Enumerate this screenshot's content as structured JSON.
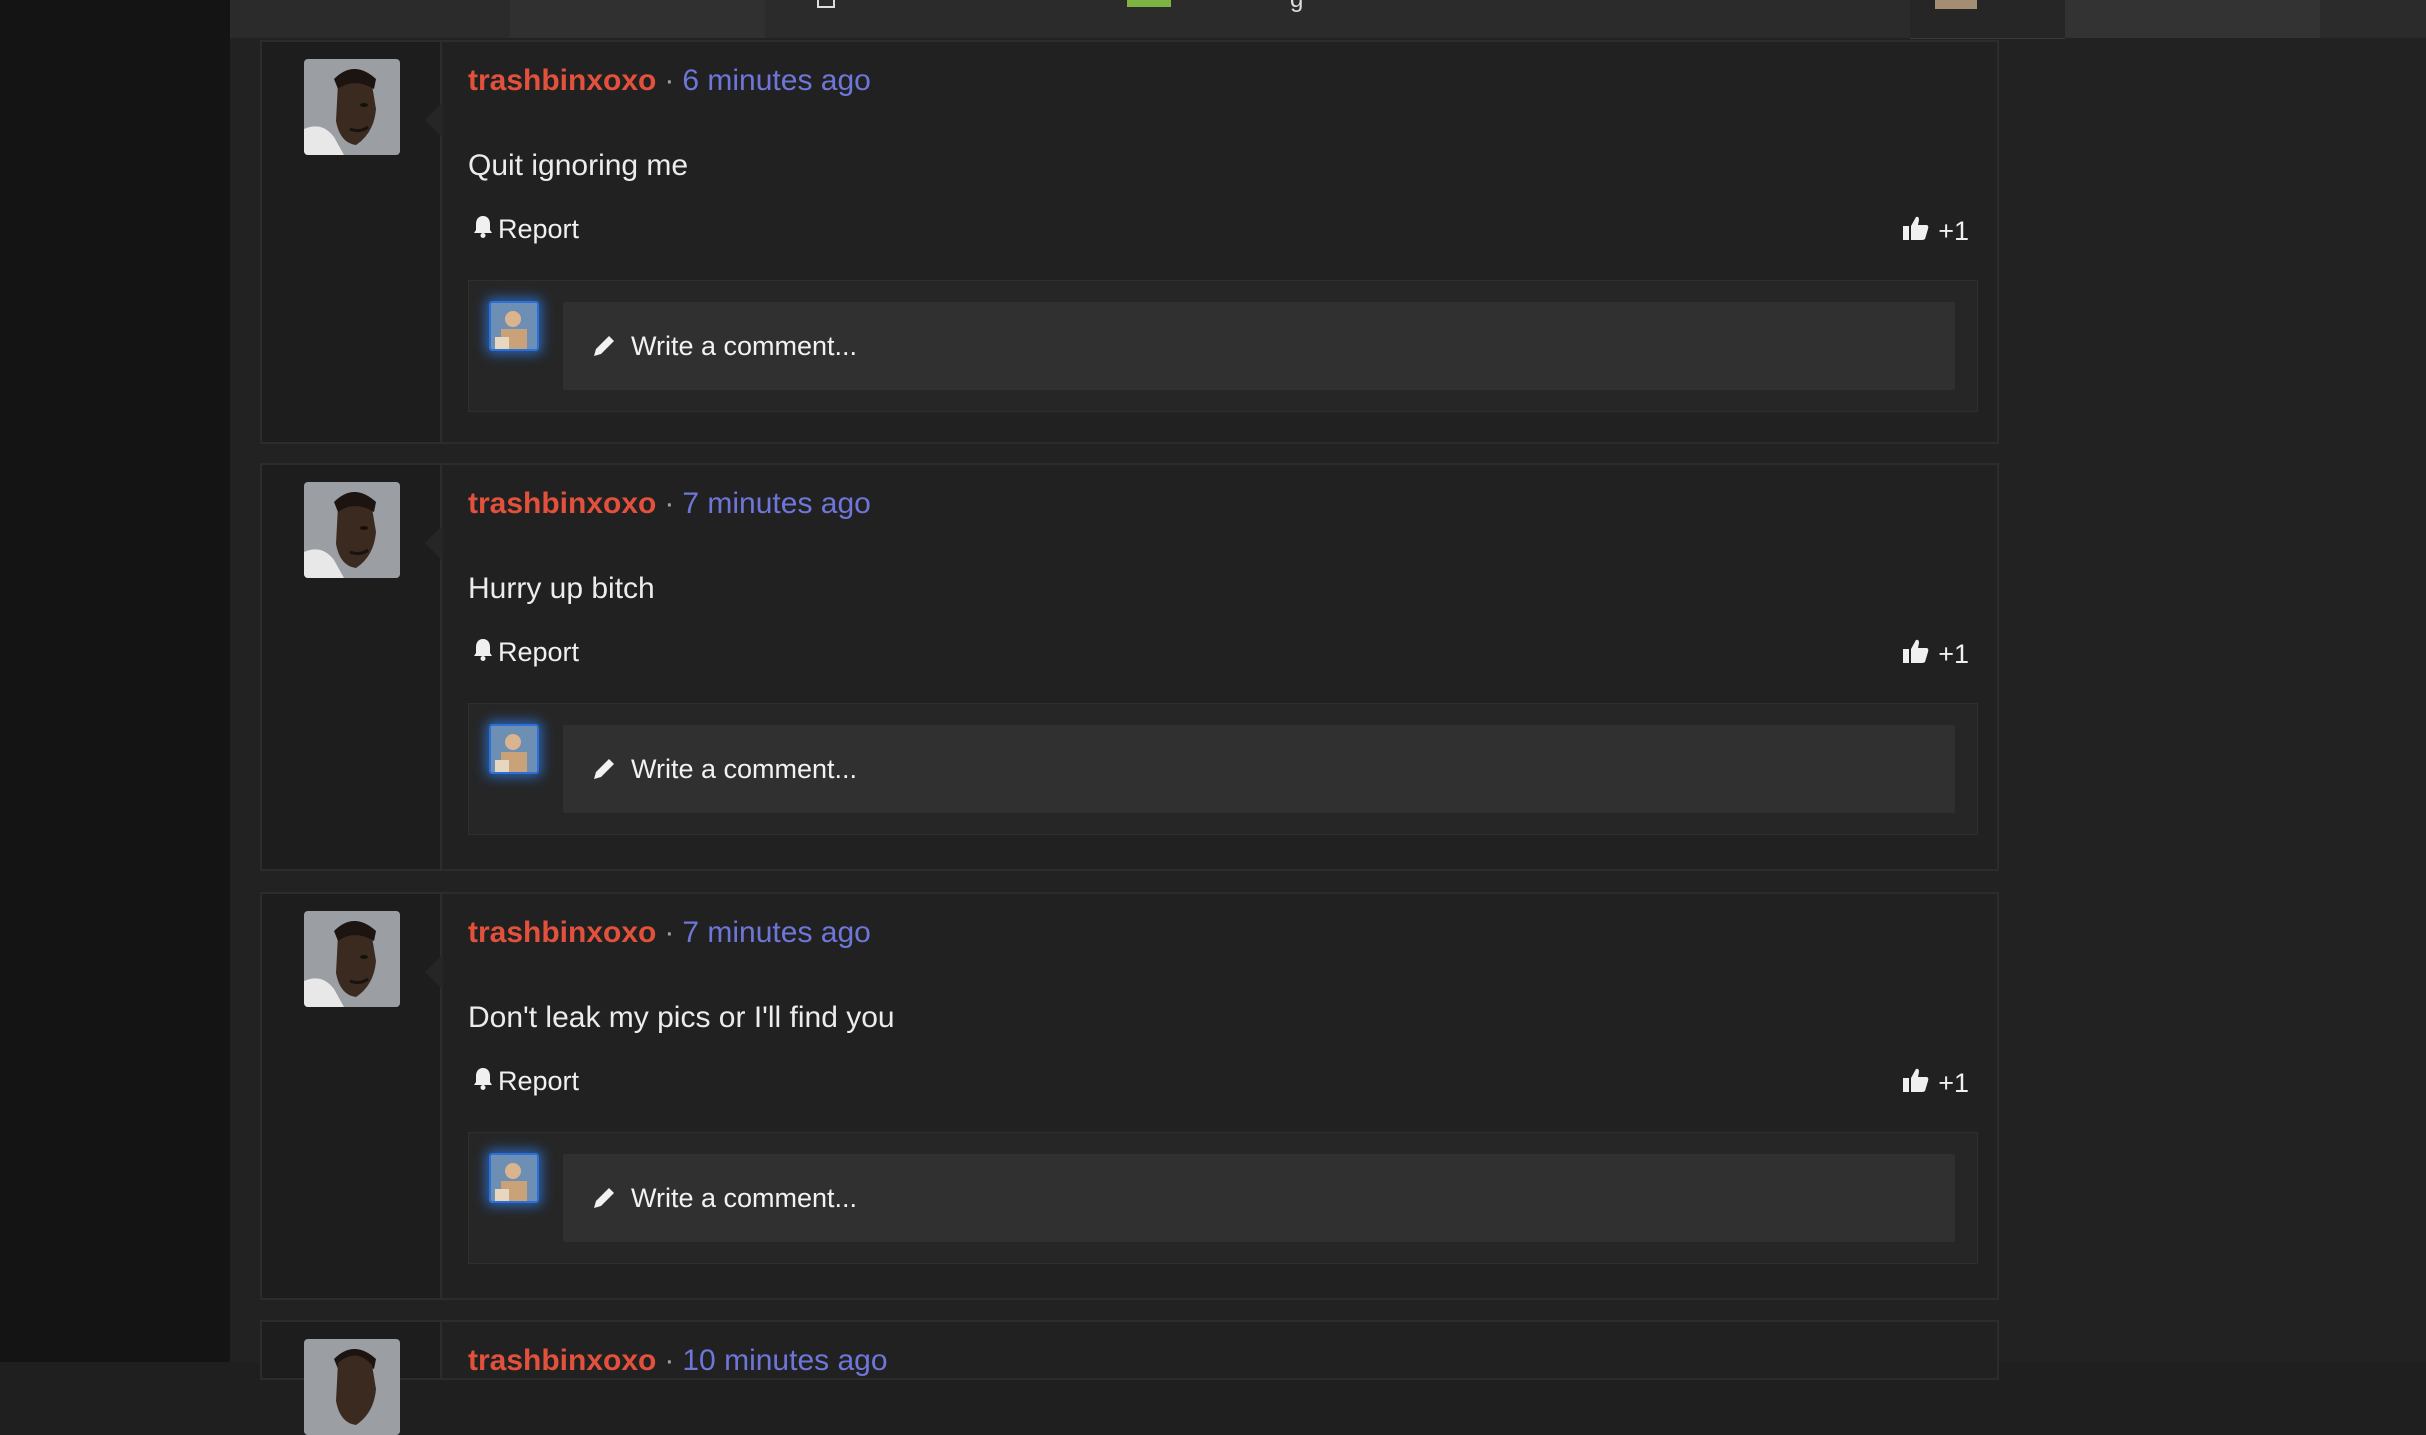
{
  "colors": {
    "username": "#e2513c",
    "timestamp": "#6f76d9",
    "avatar_glow": "#2e7ae6",
    "background": "#222222"
  },
  "header": {
    "partial_text": "g",
    "partial_text_right": "' ' '"
  },
  "posts": [
    {
      "author": "trashbinxoxo",
      "separator": "·",
      "time": "6 minutes ago",
      "body": "Quit ignoring me",
      "report_label": "Report",
      "like_count": "+1",
      "comment_placeholder": "Write a comment..."
    },
    {
      "author": "trashbinxoxo",
      "separator": "·",
      "time": "7 minutes ago",
      "body": "Hurry up bitch",
      "report_label": "Report",
      "like_count": "+1",
      "comment_placeholder": "Write a comment..."
    },
    {
      "author": "trashbinxoxo",
      "separator": "·",
      "time": "7 minutes ago",
      "body": "Don't leak my pics or I'll find you",
      "report_label": "Report",
      "like_count": "+1",
      "comment_placeholder": "Write a comment..."
    },
    {
      "author": "trashbinxoxo",
      "separator": "·",
      "time": "10 minutes ago"
    }
  ]
}
